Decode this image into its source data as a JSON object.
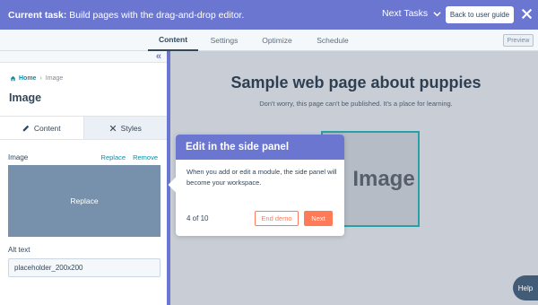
{
  "taskbar": {
    "label": "Current task:",
    "task": "Build pages with the drag-and-drop editor.",
    "next_tasks": "Next Tasks",
    "guide_button": "Back to user guide"
  },
  "editor_tabs": [
    {
      "label": "Content",
      "active": true
    },
    {
      "label": "Settings",
      "active": false
    },
    {
      "label": "Optimize",
      "active": false
    },
    {
      "label": "Schedule",
      "active": false
    }
  ],
  "preview": "Preview",
  "panel": {
    "breadcrumb_home": "Home",
    "breadcrumb_current": "Image",
    "title": "Image",
    "tab_content": "Content",
    "tab_styles": "Styles",
    "image_label": "Image",
    "replace_link": "Replace",
    "remove_link": "Remove",
    "replace_overlay": "Replace",
    "alt_label": "Alt text",
    "alt_value": "placeholder_200x200"
  },
  "canvas": {
    "title": "Sample web page about puppies",
    "subtitle": "Don't worry, this page can't be published. It's a place for learning.",
    "image_text": "Image"
  },
  "popover": {
    "title": "Edit in the side panel",
    "body": "When you add or edit a module, the side panel will become your workspace.",
    "count": "4 of 10",
    "end_demo": "End demo",
    "next": "Next"
  },
  "help": "Help",
  "colors": {
    "accent": "#6b76d0",
    "orange": "#ff7a59",
    "link": "#0091ae",
    "image_fill": "#7791ad"
  }
}
